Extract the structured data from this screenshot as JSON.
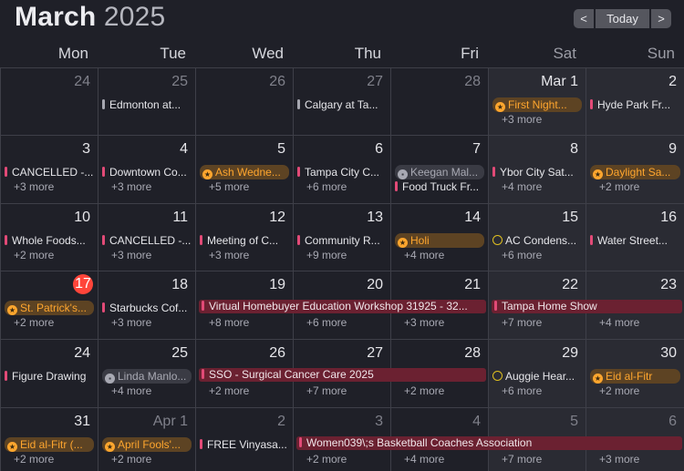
{
  "header": {
    "month": "March",
    "year": "2025",
    "prev_label": "<",
    "today_label": "Today",
    "next_label": ">"
  },
  "days_of_week": [
    "Mon",
    "Tue",
    "Wed",
    "Thu",
    "Fri",
    "Sat",
    "Sun"
  ],
  "colors": {
    "accent_event": "#e24a77",
    "holiday": "#ffa62e",
    "today": "#ff453a",
    "span_bg": "#6b2131"
  },
  "weeks": [
    [
      {
        "day": "24",
        "muted": true,
        "events": []
      },
      {
        "day": "25",
        "muted": true,
        "events": [
          {
            "text": "Edmonton at...",
            "style": "bar-gray"
          }
        ]
      },
      {
        "day": "26",
        "muted": true,
        "events": []
      },
      {
        "day": "27",
        "muted": true,
        "events": [
          {
            "text": "Calgary at Ta...",
            "style": "bar-gray"
          }
        ]
      },
      {
        "day": "28",
        "muted": true,
        "events": []
      },
      {
        "day": "Mar 1",
        "events": [
          {
            "text": "First Night...",
            "style": "pill-star"
          }
        ],
        "more": "+3 more"
      },
      {
        "day": "2",
        "events": [
          {
            "text": "Hyde Park Fr...",
            "style": "bar"
          }
        ]
      }
    ],
    [
      {
        "day": "3",
        "events": [
          {
            "text": "CANCELLED -...",
            "style": "bar"
          }
        ],
        "more": "+3 more"
      },
      {
        "day": "4",
        "events": [
          {
            "text": "Downtown Co...",
            "style": "bar"
          }
        ],
        "more": "+3 more"
      },
      {
        "day": "5",
        "events": [
          {
            "text": "Ash Wedne...",
            "style": "pill-star"
          }
        ],
        "more": "+5 more"
      },
      {
        "day": "6",
        "events": [
          {
            "text": "Tampa City C...",
            "style": "bar"
          }
        ],
        "more": "+6 more"
      },
      {
        "day": "7",
        "events": [
          {
            "text": "Keegan Mal...",
            "style": "pill-gray"
          },
          {
            "text": "Food Truck Fr...",
            "style": "bar"
          }
        ]
      },
      {
        "day": "8",
        "events": [
          {
            "text": "Ybor City Sat...",
            "style": "bar"
          }
        ],
        "more": "+4 more"
      },
      {
        "day": "9",
        "events": [
          {
            "text": "Daylight Sa...",
            "style": "pill-star"
          }
        ],
        "more": "+2 more"
      }
    ],
    [
      {
        "day": "10",
        "events": [
          {
            "text": "Whole Foods...",
            "style": "bar"
          }
        ],
        "more": "+2 more"
      },
      {
        "day": "11",
        "events": [
          {
            "text": "CANCELLED -...",
            "style": "bar"
          }
        ],
        "more": "+3 more"
      },
      {
        "day": "12",
        "events": [
          {
            "text": "Meeting of C...",
            "style": "bar"
          }
        ],
        "more": "+3 more"
      },
      {
        "day": "13",
        "events": [
          {
            "text": "Community R...",
            "style": "bar"
          }
        ],
        "more": "+9 more"
      },
      {
        "day": "14",
        "events": [
          {
            "text": "Holi",
            "style": "pill-star"
          }
        ],
        "more": "+4 more"
      },
      {
        "day": "15",
        "events": [
          {
            "text": "AC Condens...",
            "style": "ring"
          }
        ],
        "more": "+6 more"
      },
      {
        "day": "16",
        "events": [
          {
            "text": "Water Street...",
            "style": "bar"
          }
        ]
      }
    ],
    [
      {
        "day": "17",
        "today": true,
        "events": [
          {
            "text": "St. Patrick's...",
            "style": "pill-star"
          }
        ],
        "more": "+2 more"
      },
      {
        "day": "18",
        "events": [
          {
            "text": "Starbucks Cof...",
            "style": "bar"
          }
        ],
        "more": "+3 more"
      },
      {
        "day": "19",
        "events": [],
        "more": "+8 more"
      },
      {
        "day": "20",
        "events": [],
        "more": "+6 more"
      },
      {
        "day": "21",
        "events": [],
        "more": "+3 more"
      },
      {
        "day": "22",
        "events": [],
        "more": "+7 more"
      },
      {
        "day": "23",
        "events": [],
        "more": "+4 more"
      }
    ],
    [
      {
        "day": "24",
        "events": [
          {
            "text": "Figure Drawing",
            "style": "bar"
          }
        ]
      },
      {
        "day": "25",
        "events": [
          {
            "text": "Linda Manlo...",
            "style": "pill-gray"
          }
        ],
        "more": "+4 more"
      },
      {
        "day": "26",
        "events": [],
        "more": "+2 more"
      },
      {
        "day": "27",
        "events": [],
        "more": "+7 more"
      },
      {
        "day": "28",
        "events": [],
        "more": "+2 more"
      },
      {
        "day": "29",
        "events": [
          {
            "text": "Auggie Hear...",
            "style": "ring"
          }
        ],
        "more": "+6 more"
      },
      {
        "day": "30",
        "events": [
          {
            "text": "Eid al-Fitr",
            "style": "pill-star"
          }
        ],
        "more": "+2 more"
      }
    ],
    [
      {
        "day": "31",
        "events": [
          {
            "text": "Eid al-Fitr (...",
            "style": "pill-star"
          }
        ],
        "more": "+2 more"
      },
      {
        "day": "Apr 1",
        "muted": true,
        "events": [
          {
            "text": "April Fools'...",
            "style": "pill-star"
          }
        ],
        "more": "+2 more"
      },
      {
        "day": "2",
        "muted": true,
        "events": [
          {
            "text": "FREE Vinyasa...",
            "style": "bar"
          }
        ]
      },
      {
        "day": "3",
        "muted": true,
        "events": [],
        "more": "+2 more"
      },
      {
        "day": "4",
        "muted": true,
        "events": [],
        "more": "+4 more"
      },
      {
        "day": "5",
        "muted": true,
        "events": [],
        "more": "+7 more"
      },
      {
        "day": "6",
        "muted": true,
        "events": [],
        "more": "+3 more"
      }
    ]
  ],
  "spans": [
    {
      "week": 3,
      "start": 2,
      "end": 4,
      "text": "Virtual Homebuyer Education Workshop 31925 - 32..."
    },
    {
      "week": 3,
      "start": 5,
      "end": 6,
      "text": "Tampa Home Show"
    },
    {
      "week": 4,
      "start": 2,
      "end": 4,
      "text": "SSO - Surgical Cancer Care 2025"
    },
    {
      "week": 5,
      "start": 3,
      "end": 6,
      "text": "Women039\\;s Basketball Coaches Association"
    }
  ]
}
